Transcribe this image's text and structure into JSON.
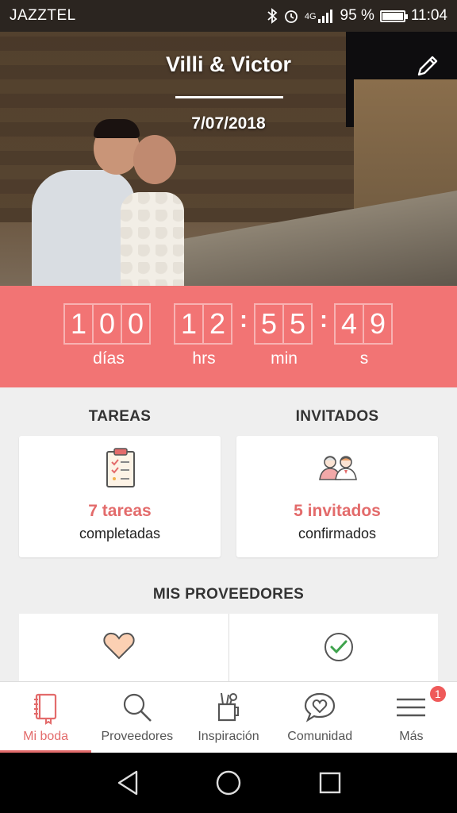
{
  "status_bar": {
    "carrier": "JAZZTEL",
    "network": "4G",
    "battery": "95 %",
    "time": "11:04"
  },
  "hero": {
    "names": "Villi & Victor",
    "date": "7/07/2018"
  },
  "countdown": {
    "days": [
      "1",
      "0",
      "0"
    ],
    "hours": [
      "1",
      "2"
    ],
    "minutes": [
      "5",
      "5"
    ],
    "seconds": [
      "4",
      "9"
    ],
    "labels": {
      "days": "días",
      "hours": "hrs",
      "minutes": "min",
      "seconds": "s"
    }
  },
  "tasks": {
    "title": "TAREAS",
    "count": "7 tareas",
    "status": "completadas"
  },
  "guests": {
    "title": "INVITADOS",
    "count": "5 invitados",
    "status": "confirmados"
  },
  "providers": {
    "title": "MIS PROVEEDORES"
  },
  "bottom_nav": {
    "items": [
      {
        "label": "Mi boda",
        "icon": "notebook-icon",
        "active": true
      },
      {
        "label": "Proveedores",
        "icon": "search-icon"
      },
      {
        "label": "Inspiración",
        "icon": "pencil-cup-icon"
      },
      {
        "label": "Comunidad",
        "icon": "chat-heart-icon"
      },
      {
        "label": "Más",
        "icon": "menu-icon",
        "badge": "1"
      }
    ]
  },
  "colors": {
    "accent": "#f27474",
    "accent_text": "#e36b6b",
    "background": "#efefef"
  }
}
